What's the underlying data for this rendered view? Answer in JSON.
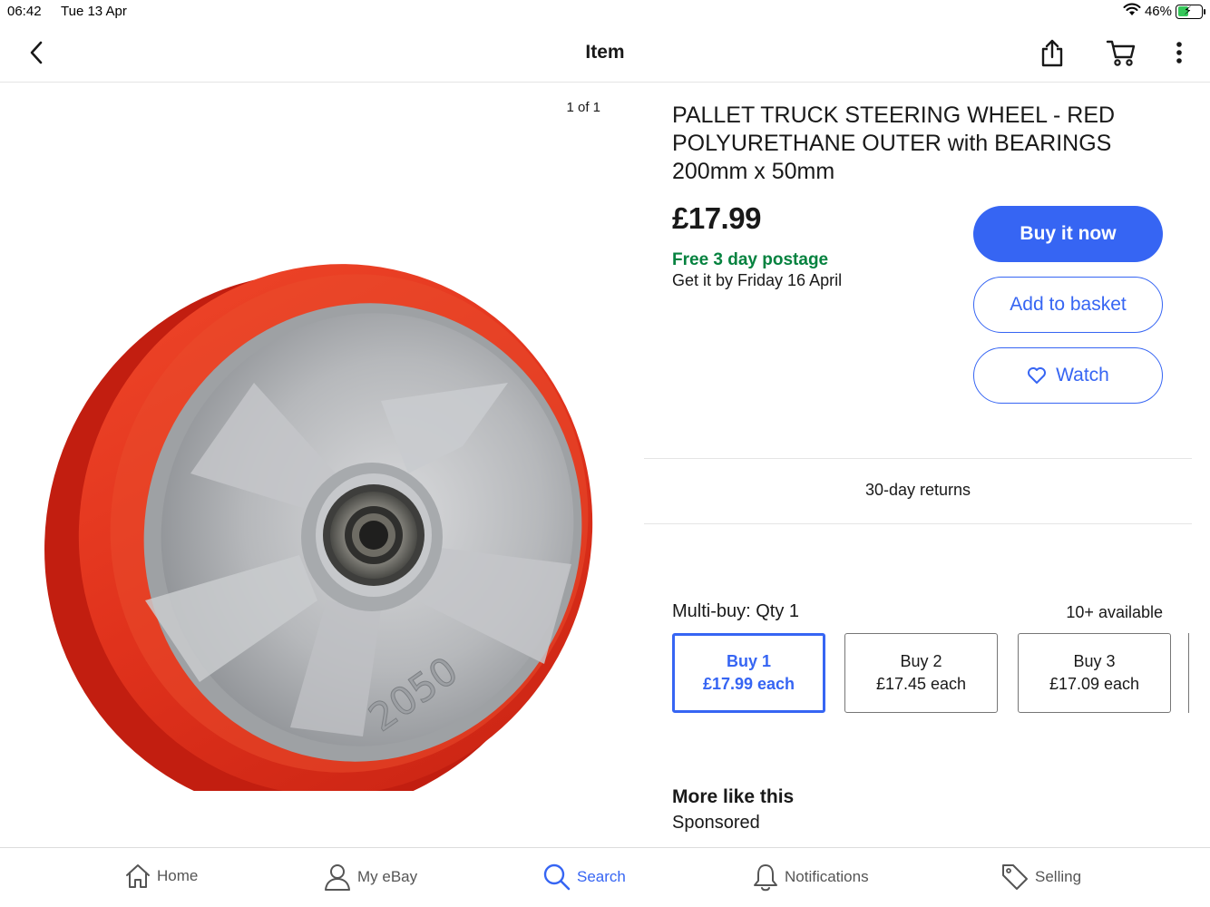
{
  "status_bar": {
    "time": "06:42",
    "date": "Tue 13 Apr",
    "battery": "46%",
    "battery_level": 0.46
  },
  "nav": {
    "title": "Item"
  },
  "gallery": {
    "counter": "1 of 1",
    "embossed_text": "2050"
  },
  "item": {
    "title": "PALLET TRUCK STEERING WHEEL - RED POLYURETHANE OUTER with BEARINGS 200mm x 50mm",
    "price": "£17.99",
    "postage": "Free 3 day postage",
    "delivery": "Get it by Friday 16 April"
  },
  "actions": {
    "buy_now": "Buy it now",
    "add_to_basket": "Add to basket",
    "watch": "Watch"
  },
  "returns": "30-day returns",
  "multibuy": {
    "label": "Multi-buy: Qty 1",
    "available": "10+ available",
    "options": [
      {
        "line1": "Buy 1",
        "line2": "£17.99 each",
        "selected": true
      },
      {
        "line1": "Buy 2",
        "line2": "£17.45 each",
        "selected": false
      },
      {
        "line1": "Buy 3",
        "line2": "£17.09 each",
        "selected": false
      }
    ]
  },
  "more_like_this": {
    "title": "More like this",
    "subtitle": "Sponsored"
  },
  "tabs": [
    {
      "label": "Home",
      "icon": "home-icon"
    },
    {
      "label": "My eBay",
      "icon": "person-icon"
    },
    {
      "label": "Search",
      "icon": "search-icon",
      "active": true
    },
    {
      "label": "Notifications",
      "icon": "bell-icon"
    },
    {
      "label": "Selling",
      "icon": "tag-icon"
    }
  ],
  "colors": {
    "accent": "#3665f3",
    "postage_green": "#05823f",
    "wheel_red": "#e0321c"
  }
}
